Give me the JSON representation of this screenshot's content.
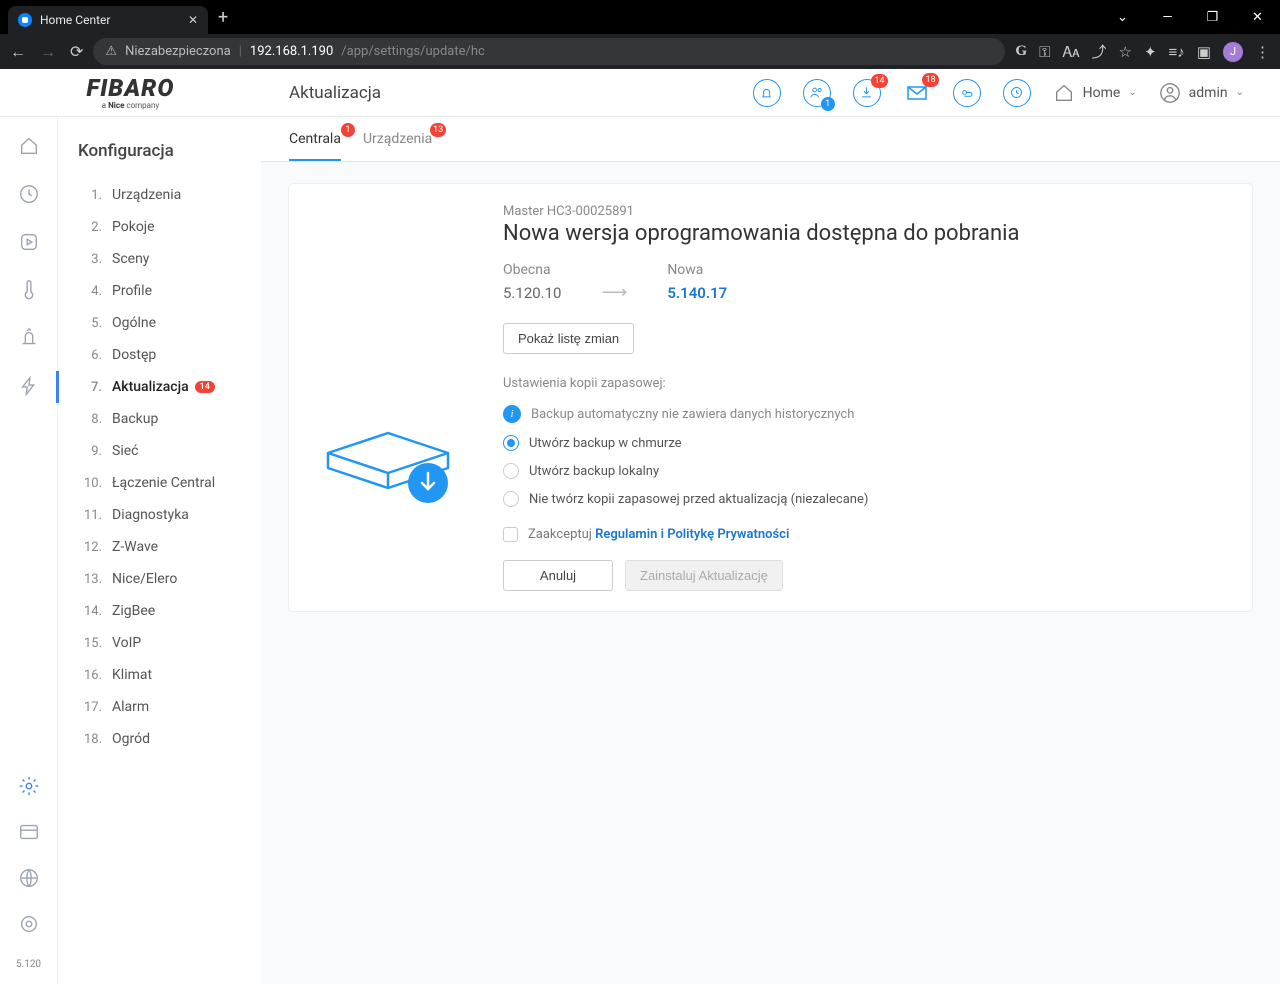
{
  "browser": {
    "tab_title": "Home Center",
    "secure_text": "Niezabezpieczona",
    "url_host": "192.168.1.190",
    "url_path": "/app/settings/update/hc",
    "profile_letter": "J"
  },
  "header": {
    "logo_main": "FIBARO",
    "logo_sub_prefix": "a ",
    "logo_sub_bold": "Nice",
    "logo_sub_suffix": " company",
    "title": "Aktualizacja",
    "badges": {
      "users": "1",
      "download": "14",
      "mail": "18"
    },
    "home_label": "Home",
    "user_label": "admin"
  },
  "sidebar": {
    "title": "Konfiguracja",
    "items": [
      {
        "n": "1.",
        "label": "Urządzenia"
      },
      {
        "n": "2.",
        "label": "Pokoje"
      },
      {
        "n": "3.",
        "label": "Sceny"
      },
      {
        "n": "4.",
        "label": "Profile"
      },
      {
        "n": "5.",
        "label": "Ogólne"
      },
      {
        "n": "6.",
        "label": "Dostęp"
      },
      {
        "n": "7.",
        "label": "Aktualizacja",
        "badge": "14",
        "active": true
      },
      {
        "n": "8.",
        "label": "Backup"
      },
      {
        "n": "9.",
        "label": "Sieć"
      },
      {
        "n": "10.",
        "label": "Łączenie Central"
      },
      {
        "n": "11.",
        "label": "Diagnostyka"
      },
      {
        "n": "12.",
        "label": "Z-Wave"
      },
      {
        "n": "13.",
        "label": "Nice/Elero"
      },
      {
        "n": "14.",
        "label": "ZigBee"
      },
      {
        "n": "15.",
        "label": "VoIP"
      },
      {
        "n": "16.",
        "label": "Klimat"
      },
      {
        "n": "17.",
        "label": "Alarm"
      },
      {
        "n": "18.",
        "label": "Ogród"
      }
    ]
  },
  "content": {
    "tabs": [
      {
        "label": "Centrala",
        "badge": "1",
        "active": true
      },
      {
        "label": "Urządzenia",
        "badge": "13"
      }
    ],
    "master": "Master HC3-00025891",
    "title": "Nowa wersja oprogramowania dostępna do pobrania",
    "current_label": "Obecna",
    "current_version": "5.120.10",
    "new_label": "Nowa",
    "new_version": "5.140.17",
    "changelog_btn": "Pokaż listę zmian",
    "backup_section": "Ustawienia kopii zapasowej:",
    "backup_info": "Backup automatyczny nie zawiera danych historycznych",
    "radio1": "Utwórz backup w chmurze",
    "radio2": "Utwórz backup lokalny",
    "radio3": "Nie twórz kopii zapasowej przed aktualizacją (niezalecane)",
    "accept_prefix": "Zaakceptuj ",
    "accept_link": "Regulamin i Politykę Prywatności",
    "cancel_btn": "Anuluj",
    "install_btn": "Zainstaluj Aktualizację"
  },
  "footer_version": "5.120"
}
